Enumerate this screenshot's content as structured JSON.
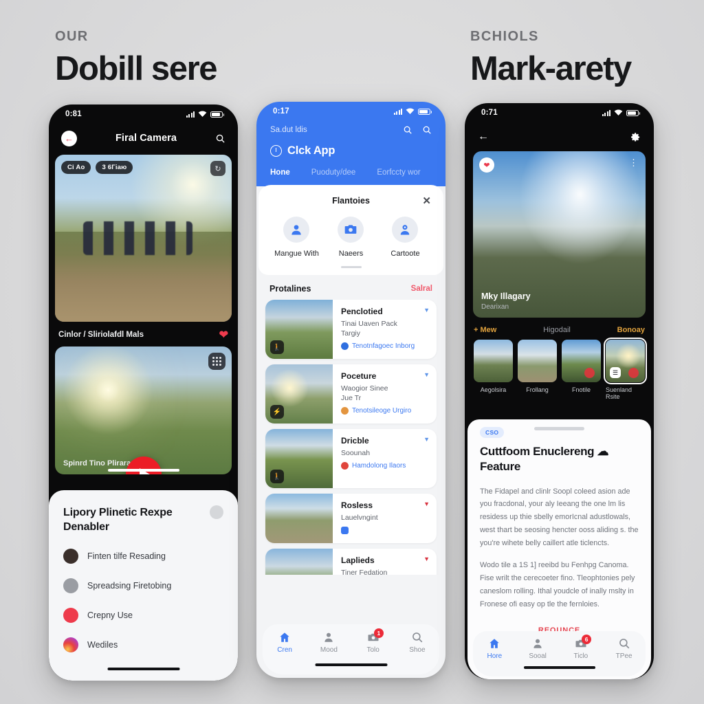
{
  "headings": {
    "left": {
      "kicker": "OUR",
      "title": "Dobill sere"
    },
    "right": {
      "kicker": "BCHIOLS",
      "title": "Mark-arety"
    }
  },
  "phone1": {
    "status": {
      "time": "0:81",
      "signal_icon": "signal-bars-icon",
      "wifi_icon": "wifi-icon",
      "battery_icon": "battery-icon"
    },
    "nav": {
      "back_icon": "back-arrow-icon",
      "title": "Firal Camera",
      "search_icon": "search-icon"
    },
    "hero": {
      "badges": [
        "Ci Ao",
        "3 6Гіаю"
      ],
      "corner_icon": "refresh-icon"
    },
    "caption": {
      "text": "Cinlor / Sliriolafdl Mals",
      "like_icon": "heart-icon"
    },
    "hero2": {
      "grid_icon": "grid-apps-icon",
      "caption": "Spinrd Tino Pliraranс",
      "play_icon": "play-icon",
      "action_icon": "person-run-icon"
    },
    "sheet": {
      "title": "Lipory Plinetiс Rexpe Denabler",
      "options": [
        {
          "label": "Finten tilfe Resading",
          "icon": "avatar-brown-icon",
          "color": "#3a2f2b"
        },
        {
          "label": "Spreadsing Firetobing",
          "icon": "compass-gray-icon",
          "color": "#9a9da3"
        },
        {
          "label": "Crepny Use",
          "icon": "calendar-red-icon",
          "color": "#ee3b4c"
        },
        {
          "label": "Wediles",
          "icon": "instagram-icon",
          "color": "#d6409f"
        }
      ]
    }
  },
  "phone2": {
    "status": {
      "time": "0:17",
      "signal_icon": "signal-bars-icon",
      "wifi_icon": "wifi-icon",
      "battery_icon": "battery-icon"
    },
    "search_row": {
      "label": "Sa.dut ldis",
      "icon_left": "search-icon",
      "icon_right": "search-icon"
    },
    "brand": {
      "logo_icon": "clock-logo-icon",
      "name": "Clck App"
    },
    "tabs": [
      {
        "label": "Hone",
        "active": true
      },
      {
        "label": "Puoduty/dee",
        "active": false
      },
      {
        "label": "Eorfccty wor",
        "active": false
      }
    ],
    "card": {
      "title": "Flantoies",
      "close_icon": "close-icon",
      "items": [
        {
          "label": "Mangue With",
          "icon": "person-icon"
        },
        {
          "label": "Naeers",
          "icon": "camera-icon"
        },
        {
          "label": "Cartoote",
          "icon": "profile-badge-icon"
        }
      ]
    },
    "section": {
      "title": "Protalines",
      "action": "Salral"
    },
    "list": [
      {
        "title": "Penclotied",
        "sub": "Tinai Uaven Pack\nTargiy",
        "link": "Tenotnfagoec Inborg",
        "link_dot": "#2f6fe0",
        "badge_icon": "person-run-icon",
        "caret_icon": "caret-down-icon",
        "caret_color": "#5f95e8",
        "thumb": "t-a"
      },
      {
        "title": "Poceture",
        "sub": "Waogior Sinee\nJue Tr",
        "link": "Tenotsileoge Urgiro",
        "link_dot": "#e3953f",
        "badge_icon": "bolt-icon",
        "caret_icon": "caret-down-icon",
        "caret_color": "#5f95e8",
        "thumb": "t-b"
      },
      {
        "title": "Dricble",
        "sub": "Soounah",
        "link": "Hamdolong Ilaors",
        "link_dot": "#e0453c",
        "badge_icon": "walk-icon",
        "caret_icon": "caret-down-icon",
        "caret_color": "#5f95e8",
        "thumb": "t-c"
      },
      {
        "title": "Rosless",
        "sub": "Lauelvngint",
        "link": "",
        "link_dot": "#3b78f0",
        "badge_icon": "",
        "caret_icon": "caret-down-icon",
        "caret_color": "#d8323f",
        "thumb": "t-d"
      },
      {
        "title": "Laplieds",
        "sub": "Tiner Fedation\nConfel",
        "link": "",
        "link_dot": "#3b78f0",
        "badge_icon": "walk-icon",
        "caret_icon": "caret-down-icon",
        "caret_color": "#d8323f",
        "thumb": "t-e"
      }
    ],
    "tabbar": [
      {
        "label": "Cren",
        "icon": "home-icon",
        "active": true,
        "badge": ""
      },
      {
        "label": "Mood",
        "icon": "person-icon",
        "active": false,
        "badge": ""
      },
      {
        "label": "Tolo",
        "icon": "camera-icon",
        "active": false,
        "badge": "1"
      },
      {
        "label": "Shoe",
        "icon": "search-icon",
        "active": false,
        "badge": ""
      }
    ]
  },
  "phone3": {
    "status": {
      "time": "0:71",
      "signal_icon": "signal-bars-icon",
      "wifi_icon": "wifi-icon",
      "battery_icon": "battery-icon"
    },
    "nav": {
      "back_icon": "back-arrow-icon",
      "settings_icon": "gear-icon"
    },
    "hero": {
      "like_icon": "heart-badge-icon",
      "menu_icon": "kebab-menu-icon",
      "title": "Mky Illagary",
      "subtitle": "Dearixan"
    },
    "strip": {
      "new": "+ Mew",
      "middle": "Higodail",
      "right": "Bonoay"
    },
    "gallery": [
      {
        "label": "Aegolsira",
        "thumb": "g-a",
        "selected": false,
        "blob": false,
        "stack": false
      },
      {
        "label": "Frollang",
        "thumb": "g-b",
        "selected": false,
        "blob": false,
        "stack": false
      },
      {
        "label": "Fnotile",
        "thumb": "g-c",
        "selected": false,
        "blob": true,
        "stack": false
      },
      {
        "label": "Suenland Rsite",
        "thumb": "g-d",
        "selected": true,
        "blob": true,
        "stack": true
      }
    ],
    "sheet": {
      "chip": "CSO",
      "heading": "Cuttfoom Enuclereng ☁ Feature",
      "para1": "The Fidapel and clinlr Soopl coleed asion ade you fracdonal, your aly Ieeang the one lm lis residess up thie sbelly emorIcnal adustlowals, west thart be seosing hencter ooss aliding s. the you're wihete belly caillert atle ticlencts.",
      "para2": "Wodo tile a 1S 1] reeibd bu Fenhpg Canoma. Fise wrilt the cerecoeter fino. Tleophtonies pely caneslom rolling. Ithal youdcle of inally mslty in Fronese ofi easy op tle the fernloies.",
      "cta": "REOUNCE"
    },
    "tabbar": [
      {
        "label": "Hore",
        "icon": "home-icon",
        "active": true,
        "badge": ""
      },
      {
        "label": "Sooal",
        "icon": "person-icon",
        "active": false,
        "badge": ""
      },
      {
        "label": "Ticlo",
        "icon": "camera-icon",
        "active": false,
        "badge": "6"
      },
      {
        "label": "TPee",
        "icon": "search-icon",
        "active": false,
        "badge": ""
      }
    ]
  }
}
